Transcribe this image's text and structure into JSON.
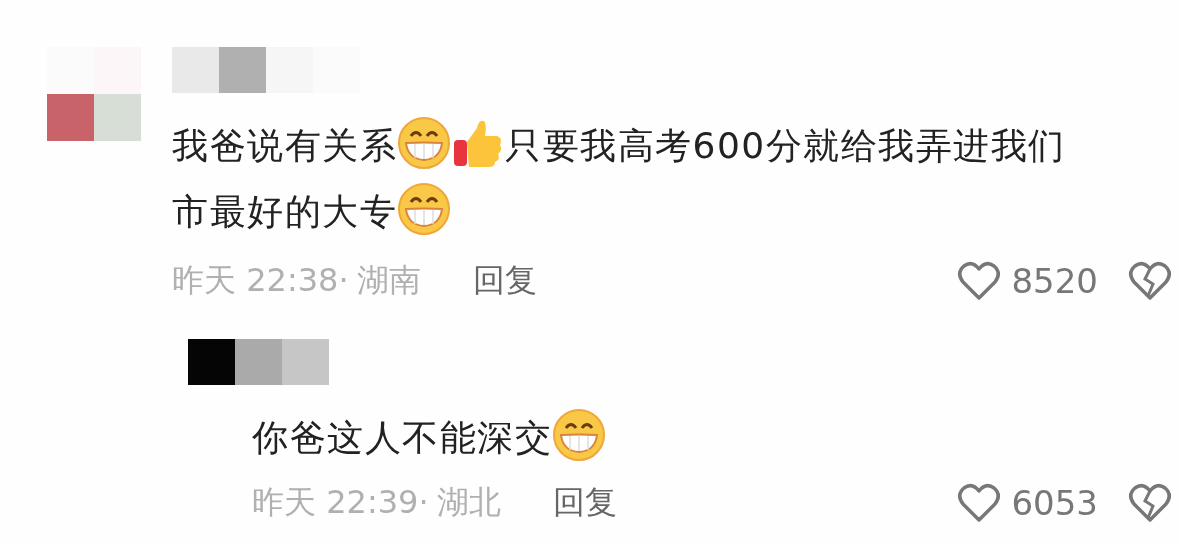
{
  "comments": [
    {
      "content": [
        {
          "kind": "text",
          "text": "我爸说有关系"
        },
        {
          "kind": "grin"
        },
        {
          "kind": "thumbs"
        },
        {
          "kind": "text",
          "text": "只要我高考600分就给我弄进我们市最好的大专"
        },
        {
          "kind": "grin"
        }
      ],
      "time": "昨天 22:38·",
      "location": "湖南",
      "reply_label": "回复",
      "likes": "8520",
      "liked": false,
      "disliked": false,
      "replies": [
        {
          "content": [
            {
              "kind": "text",
              "text": "你爸这人不能深交"
            },
            {
              "kind": "grin"
            }
          ],
          "time": "昨天 22:39·",
          "location": "湖北",
          "reply_label": "回复",
          "likes": "6053",
          "liked": false,
          "disliked": false
        }
      ]
    }
  ]
}
